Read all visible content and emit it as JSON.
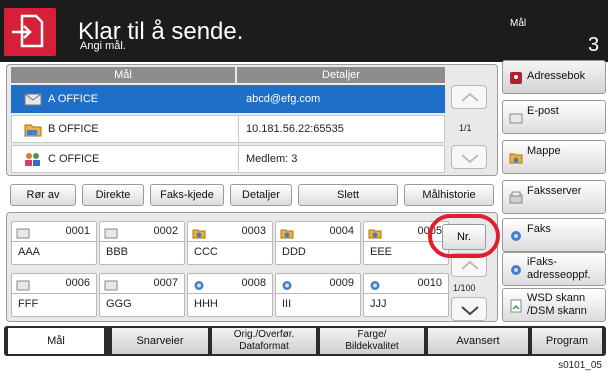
{
  "header": {
    "title": "Klar til å sende.",
    "subtitle": "Angi mål.",
    "destination_label": "Mål",
    "destination_count": "3",
    "accent_color": "#d6203a"
  },
  "destination_list": {
    "col_destination": "Mål",
    "col_details": "Detaljer",
    "page_indicator": "1/1",
    "rows": [
      {
        "name": "A OFFICE",
        "detail": "abcd@efg.com",
        "icon": "email-icon",
        "selected": true
      },
      {
        "name": "B OFFICE",
        "detail": "10.181.56.22:65535",
        "icon": "folder-icon",
        "selected": false
      },
      {
        "name": "C OFFICE",
        "detail": "Medlem:   3",
        "icon": "group-icon",
        "selected": false
      }
    ]
  },
  "toolbar": {
    "remove_label": "Rør av",
    "direct_label": "Direkte",
    "fax_chain_label": "Faks-kjede",
    "details_label": "Detaljer",
    "delete_label": "Slett",
    "history_label": "Målhistorie"
  },
  "one_touch": {
    "page_indicator": "1/100",
    "number_button_label": "Nr.",
    "keys": [
      {
        "num": "0001",
        "name": "AAA",
        "icon": "email-icon"
      },
      {
        "num": "0002",
        "name": "BBB",
        "icon": "email-icon"
      },
      {
        "num": "0003",
        "name": "CCC",
        "icon": "folder-icon"
      },
      {
        "num": "0004",
        "name": "DDD",
        "icon": "folder-icon"
      },
      {
        "num": "0005",
        "name": "EEE",
        "icon": "folder-icon"
      },
      {
        "num": "0006",
        "name": "FFF",
        "icon": "email-icon"
      },
      {
        "num": "0007",
        "name": "GGG",
        "icon": "email-icon"
      },
      {
        "num": "0008",
        "name": "HHH",
        "icon": "fax-icon"
      },
      {
        "num": "0009",
        "name": "III",
        "icon": "fax-icon"
      },
      {
        "num": "0010",
        "name": "JJJ",
        "icon": "fax-icon"
      }
    ]
  },
  "side_menu": {
    "address_book": "Adressebok",
    "email": "E-post",
    "folder": "Mappe",
    "fax_server": "Faksserver",
    "fax": "Faks",
    "ifax_1": "iFaks-",
    "ifax_2": "adresseoppf.",
    "wsd_1": "WSD skann",
    "wsd_2": "/DSM skann"
  },
  "tabs": {
    "destination": "Mål",
    "shortcuts": "Snarveier",
    "orig_1": "Orig./Overfør.",
    "orig_2": "Dataformat",
    "color_1": "Farge/",
    "color_2": "Bildekvalitet",
    "advanced": "Avansert",
    "program": "Program"
  },
  "footnote": "s0101_05"
}
